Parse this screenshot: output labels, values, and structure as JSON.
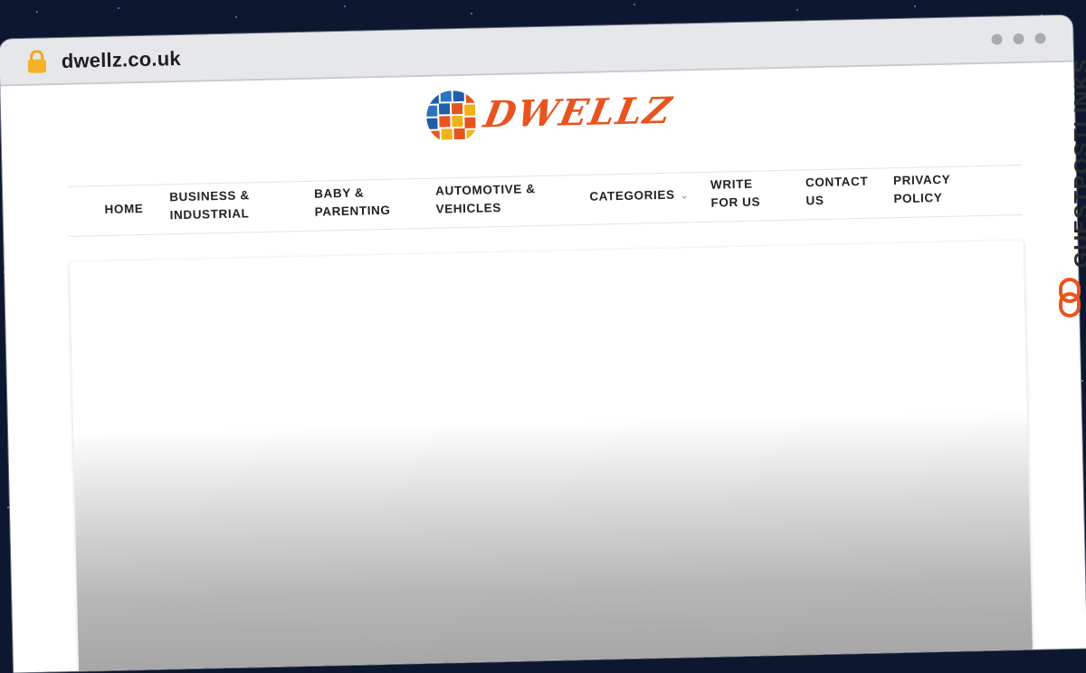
{
  "browser": {
    "url": "dwellz.co.uk"
  },
  "site": {
    "logo_text": "DWELLZ"
  },
  "nav": {
    "items": [
      {
        "line1": "HOME",
        "line2": ""
      },
      {
        "line1": "BUSINESS &",
        "line2": "INDUSTRIAL"
      },
      {
        "line1": "BABY &",
        "line2": "PARENTING"
      },
      {
        "line1": "AUTOMOTIVE &",
        "line2": "VEHICLES"
      },
      {
        "line1": "CATEGORIES",
        "line2": ""
      },
      {
        "line1": "WRITE",
        "line2": "FOR US"
      },
      {
        "line1": "CONTACT",
        "line2": "US"
      },
      {
        "line1": "PRIVACY",
        "line2": "POLICY"
      }
    ]
  },
  "watermark": {
    "text": "GUESTPOSTLINKS"
  },
  "colors": {
    "brand_orange": "#e8541f",
    "globe_blue": "#1f5fa8",
    "globe_yellow": "#f2b318",
    "background": "#0d1830"
  }
}
